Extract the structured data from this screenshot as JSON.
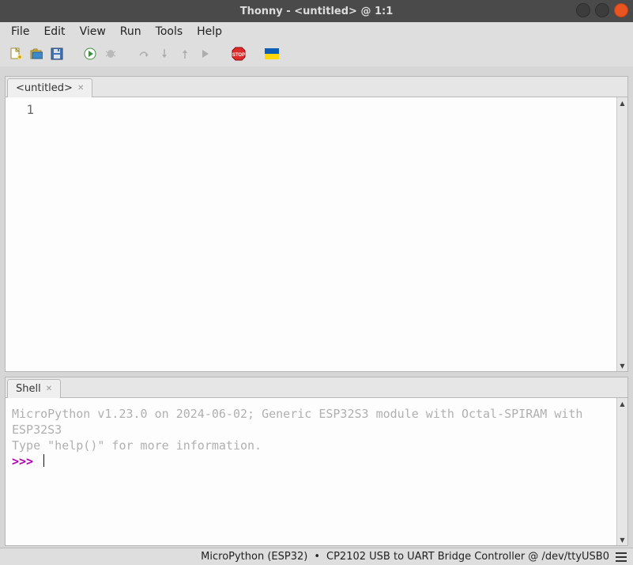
{
  "title": "Thonny  -  <untitled>  @ 1:1",
  "menus": [
    "File",
    "Edit",
    "View",
    "Run",
    "Tools",
    "Help"
  ],
  "toolbar": {
    "icons": [
      {
        "name": "new-file-icon",
        "enabled": true
      },
      {
        "name": "open-file-icon",
        "enabled": true
      },
      {
        "name": "save-file-icon",
        "enabled": true
      }
    ],
    "runIcons": [
      {
        "name": "run-icon",
        "enabled": true
      },
      {
        "name": "debug-icon",
        "enabled": false
      }
    ],
    "debugIcons": [
      {
        "name": "step-over-icon",
        "enabled": false
      },
      {
        "name": "step-into-icon",
        "enabled": false
      },
      {
        "name": "step-out-icon",
        "enabled": false
      },
      {
        "name": "resume-icon",
        "enabled": false
      }
    ],
    "endIcons": [
      {
        "name": "stop-icon",
        "enabled": true
      },
      {
        "name": "flag-icon",
        "enabled": true
      }
    ]
  },
  "editor": {
    "tab": {
      "label": "<untitled>"
    },
    "lineNumber": "1",
    "content": ""
  },
  "shell": {
    "tab": {
      "label": "Shell"
    },
    "banner1": "MicroPython v1.23.0 on 2024-06-02; Generic ESP32S3 module with Octal-SPIRAM with ESP32S3",
    "banner2": "Type \"help()\" for more information.",
    "prompt": ">>> "
  },
  "status": {
    "interpreter": "MicroPython (ESP32)",
    "sep": "•",
    "port": "CP2102 USB to UART Bridge Controller @ /dev/ttyUSB0"
  }
}
